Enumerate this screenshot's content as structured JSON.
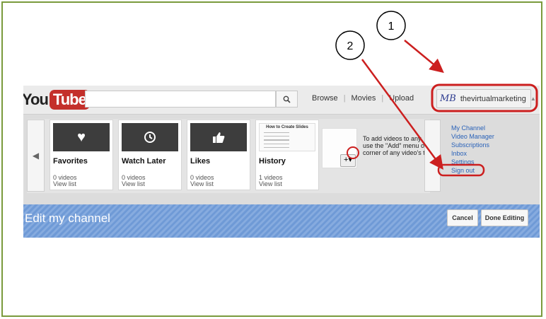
{
  "logo": {
    "you": "You",
    "tube": "Tube"
  },
  "search": {
    "placeholder": ""
  },
  "nav": {
    "browse": "Browse",
    "movies": "Movies",
    "upload": "Upload"
  },
  "user": {
    "avatar_initials": "MB",
    "name": "thevirtualmarketing"
  },
  "cards": [
    {
      "title": "Favorites",
      "count": "0 videos",
      "link": "View list"
    },
    {
      "title": "Watch Later",
      "count": "0 videos",
      "link": "View list"
    },
    {
      "title": "Likes",
      "count": "0 videos",
      "link": "View list"
    },
    {
      "title": "History",
      "count": "1 videos",
      "link": "View list",
      "thumb_title": "How to Create Slides"
    }
  ],
  "promo": {
    "line1": "To add videos to any",
    "line2": "use the \"Add\" menu o",
    "line3": "corner of any video's t"
  },
  "menu": [
    "My Channel",
    "Video Manager",
    "Subscriptions",
    "Inbox",
    "Settings",
    "Sign out"
  ],
  "banner": {
    "title": "Edit my channel",
    "cancel": "Cancel",
    "done": "Done Editing"
  },
  "annotations": [
    "1",
    "2"
  ],
  "colors": {
    "annotation": "#cc1f1f",
    "brand_red": "#c4302b",
    "banner_blue": "#6f9ad6",
    "link_blue": "#2a62b8",
    "frame_green": "#7a9a3c"
  }
}
